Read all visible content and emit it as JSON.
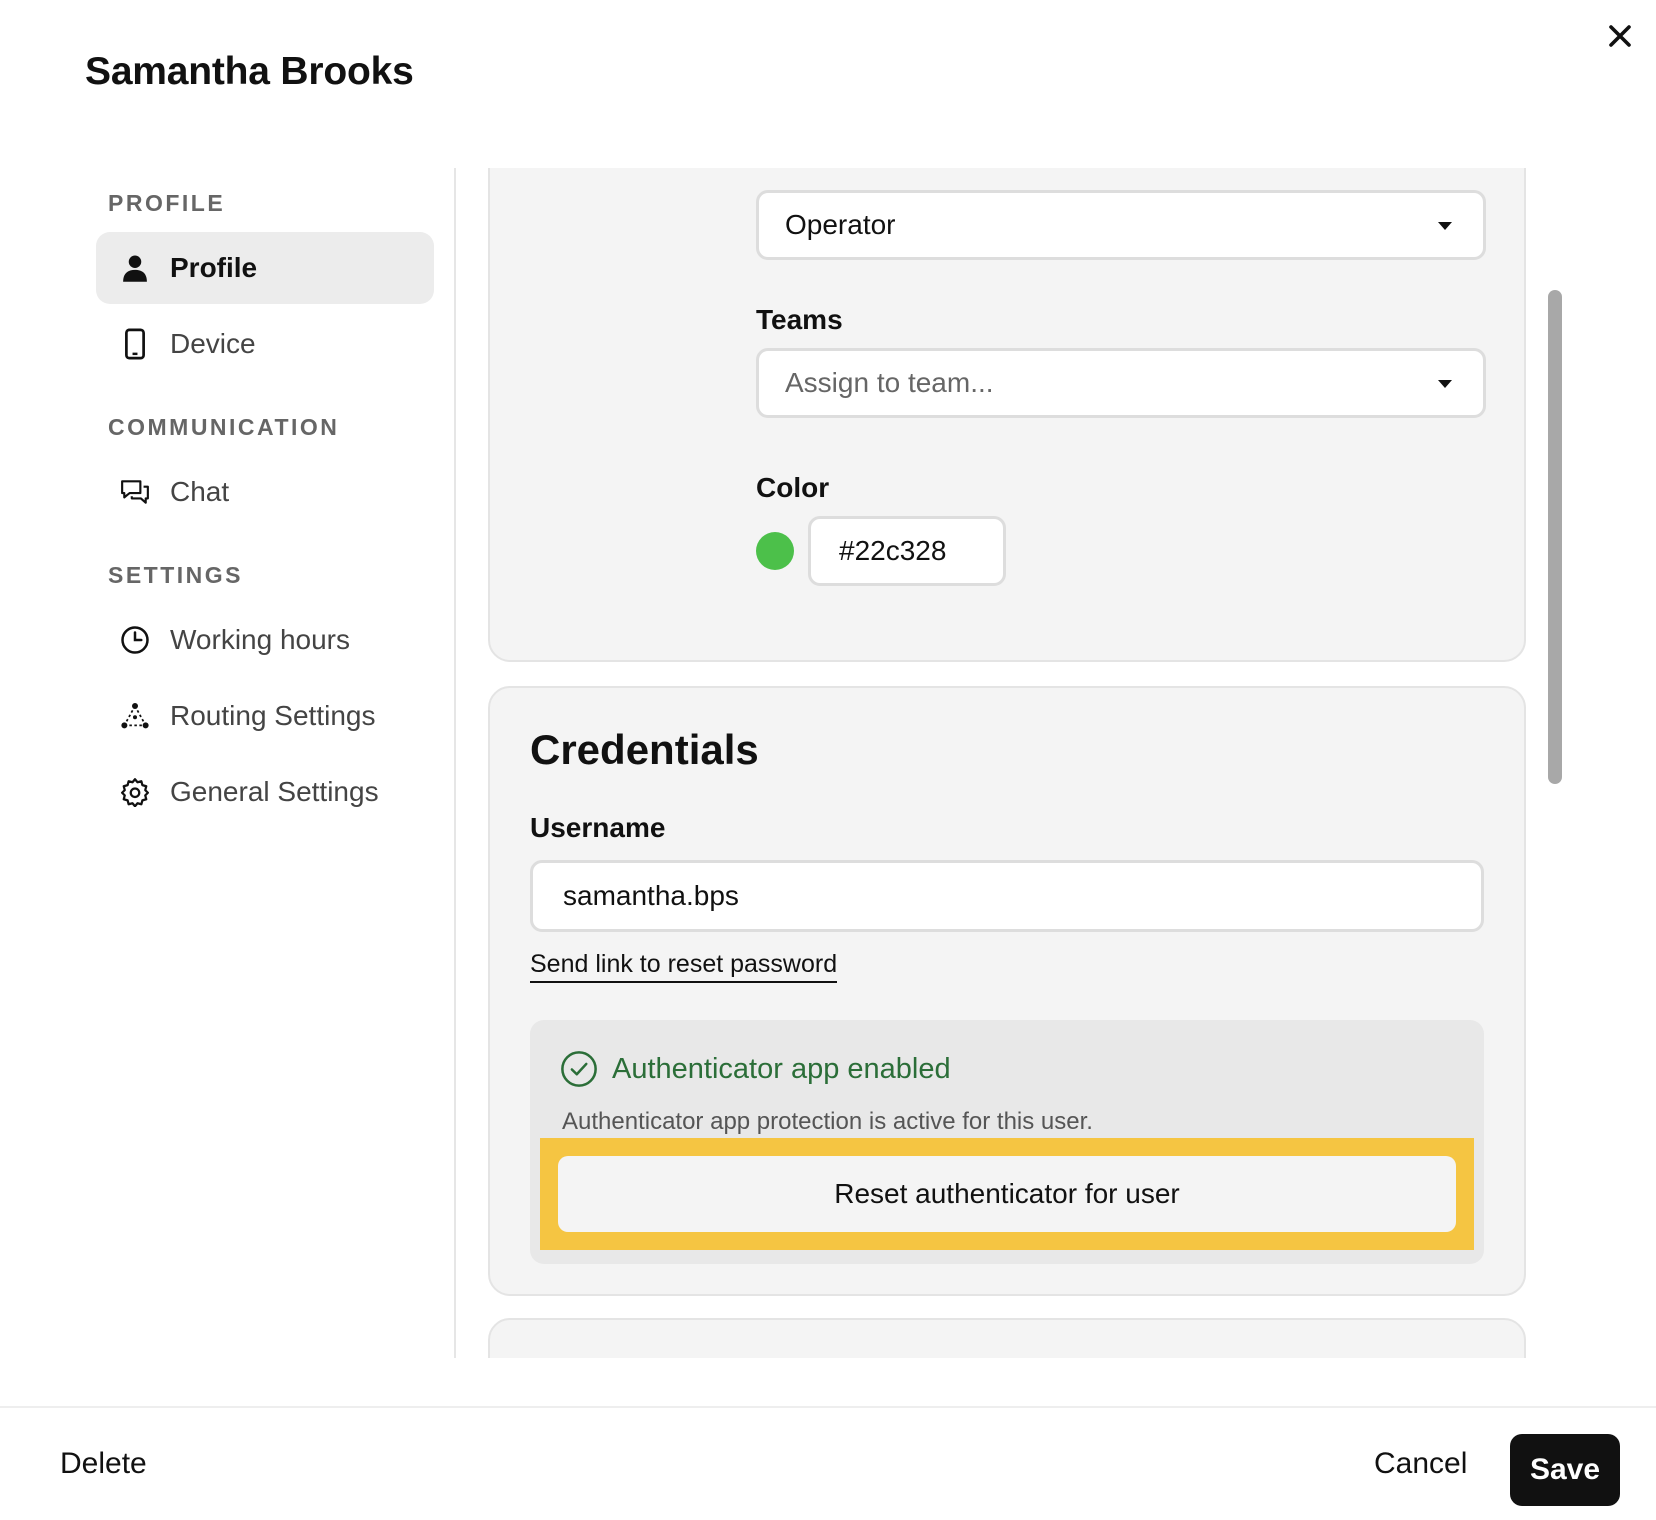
{
  "dialog": {
    "title": "Samantha Brooks",
    "close_icon": "close-icon"
  },
  "sidebar": {
    "sections": [
      {
        "label": "PROFILE",
        "items": [
          {
            "label": "Profile",
            "icon": "person-icon",
            "active": true
          },
          {
            "label": "Device",
            "icon": "phone-icon",
            "active": false
          }
        ]
      },
      {
        "label": "COMMUNICATION",
        "items": [
          {
            "label": "Chat",
            "icon": "chat-bubbles-icon",
            "active": false
          }
        ]
      },
      {
        "label": "SETTINGS",
        "items": [
          {
            "label": "Working hours",
            "icon": "clock-icon",
            "active": false
          },
          {
            "label": "Routing Settings",
            "icon": "routing-nodes-icon",
            "active": false
          },
          {
            "label": "General Settings",
            "icon": "gear-icon",
            "active": false
          }
        ]
      }
    ]
  },
  "profile_card": {
    "role_select": {
      "value": "Operator"
    },
    "teams": {
      "label": "Teams",
      "placeholder": "Assign to team..."
    },
    "color": {
      "label": "Color",
      "value": "#22c328",
      "swatch": "#4cc04a"
    }
  },
  "credentials": {
    "title": "Credentials",
    "username_label": "Username",
    "username_value": "samantha.bps",
    "reset_password_link": "Send link to reset password",
    "authenticator": {
      "status": "Authenticator app enabled",
      "status_color": "#2b6e38",
      "description": "Authenticator app protection is active for this user.",
      "reset_button": "Reset authenticator for user",
      "highlight_color": "#f5c542"
    }
  },
  "footer": {
    "delete": "Delete",
    "cancel": "Cancel",
    "save": "Save"
  }
}
